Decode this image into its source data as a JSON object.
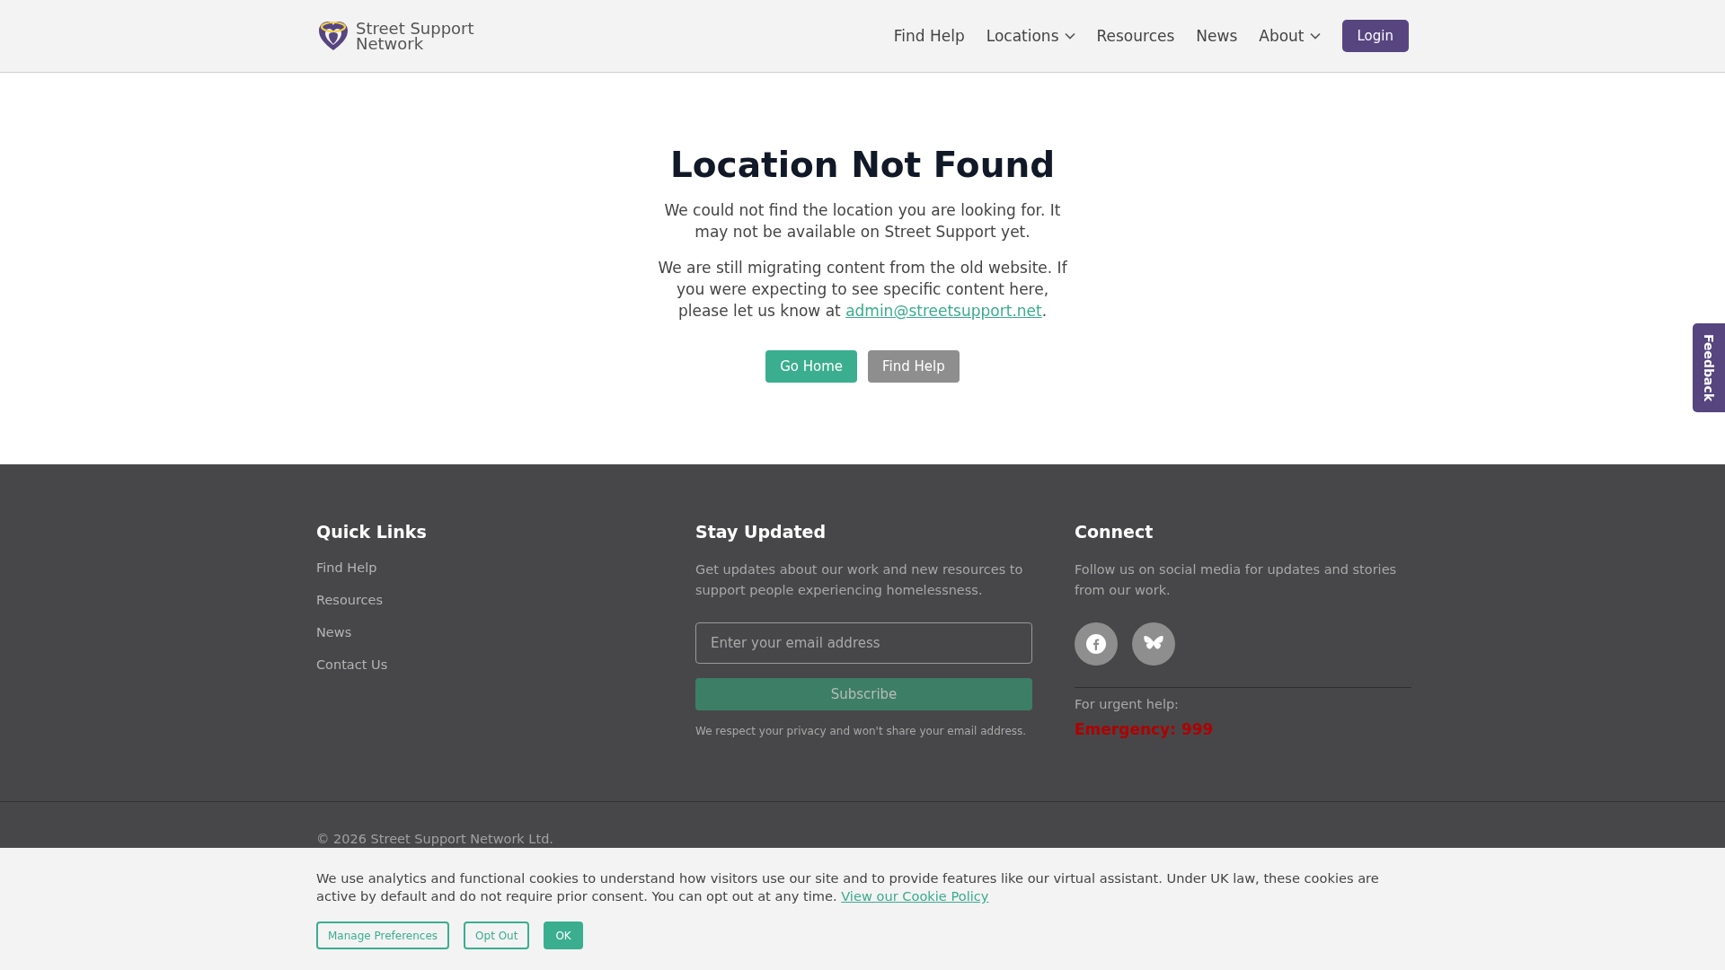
{
  "header": {
    "logo_text": "Street Support Network",
    "nav": [
      {
        "label": "Find Help",
        "has_menu": false
      },
      {
        "label": "Locations",
        "has_menu": true
      },
      {
        "label": "Resources",
        "has_menu": false
      },
      {
        "label": "News",
        "has_menu": false
      },
      {
        "label": "About",
        "has_menu": true
      }
    ],
    "login": "Login"
  },
  "main": {
    "title": "Location Not Found",
    "paragraph_1": "We could not find the location you are looking for. It may not be available on Street Support yet.",
    "paragraph_2": "We are still migrating content from the old website. If you were expecting to see specific content here, please let us know at",
    "email_link": "admin@streetsupport.net",
    "paragraph_2_end": ".",
    "buttons": [
      {
        "label": "Go Home",
        "kind": "primary"
      },
      {
        "label": "Find Help",
        "kind": "secondary"
      }
    ]
  },
  "footer": {
    "quick_links": {
      "title": "Quick Links",
      "links": [
        "Find Help",
        "Resources",
        "News",
        "Contact Us"
      ]
    },
    "stay_updated": {
      "title": "Stay Updated",
      "text": "Get updates about our work and new resources to support people experiencing homelessness.",
      "placeholder": "Enter your email address",
      "button": "Subscribe",
      "note": "We respect your privacy and won't share your email address."
    },
    "connect": {
      "title": "Connect",
      "text": "Follow us on social media for updates and stories from our work.",
      "social": [
        {
          "kind": "facebook"
        },
        {
          "kind": "butterfly"
        }
      ],
      "urgent_label": "For urgent help:",
      "emergency": "Emergency: 999"
    },
    "copyright": "© 2026 Street Support Network Ltd."
  },
  "cookie_banner": {
    "text": "We use analytics and functional cookies to understand how visitors use our site and to provide features like our virtual assistant. Under UK law, these cookies are active by default and do not require prior consent. You can opt out at any time.",
    "link": "View our Cookie Policy",
    "buttons": [
      {
        "label": "Manage Preferences",
        "kind": "outline"
      },
      {
        "label": "Opt Out",
        "kind": "outline"
      },
      {
        "label": "OK",
        "kind": "filled"
      }
    ]
  },
  "feedback_tab": "Feedback"
}
